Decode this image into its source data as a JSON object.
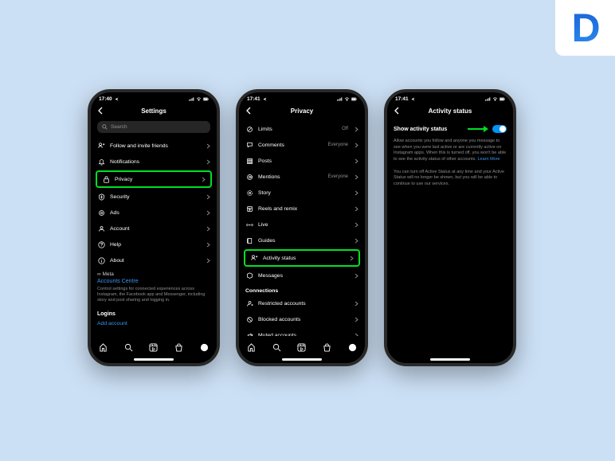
{
  "logo": {
    "letter": "D"
  },
  "status": {
    "time": "17:40",
    "nav_icon": "✈",
    "signal": "▪▪▪",
    "wifi": "⬡",
    "battery": "■"
  },
  "status2": {
    "time": "17:41"
  },
  "status3": {
    "time": "17:41"
  },
  "screen1": {
    "title": "Settings",
    "search_placeholder": "Search",
    "rows": [
      {
        "icon": "invite",
        "label": "Follow and invite friends"
      },
      {
        "icon": "bell",
        "label": "Notifications"
      },
      {
        "icon": "lock",
        "label": "Privacy",
        "highlight": true
      },
      {
        "icon": "shield",
        "label": "Security"
      },
      {
        "icon": "ads",
        "label": "Ads"
      },
      {
        "icon": "person",
        "label": "Account"
      },
      {
        "icon": "help",
        "label": "Help"
      },
      {
        "icon": "info",
        "label": "About"
      }
    ],
    "meta": {
      "logo": "∞ Meta",
      "accounts_centre": "Accounts Centre",
      "desc": "Control settings for connected experiences across Instagram, the Facebook app and Messenger, including story and post sharing and logging in."
    },
    "logins_header": "Logins",
    "add_account": "Add account"
  },
  "screen2": {
    "title": "Privacy",
    "rows_top": [
      {
        "icon": "limits",
        "label": "Limits",
        "value": "Off"
      },
      {
        "icon": "comments",
        "label": "Comments",
        "value": "Everyone"
      },
      {
        "icon": "posts",
        "label": "Posts"
      },
      {
        "icon": "mentions",
        "label": "Mentions",
        "value": "Everyone"
      },
      {
        "icon": "story",
        "label": "Story"
      },
      {
        "icon": "reels",
        "label": "Reels and remix"
      },
      {
        "icon": "live",
        "label": "Live"
      },
      {
        "icon": "guides",
        "label": "Guides"
      },
      {
        "icon": "activity",
        "label": "Activity status",
        "highlight": true
      },
      {
        "icon": "messages",
        "label": "Messages"
      }
    ],
    "connections_header": "Connections",
    "rows_conn": [
      {
        "icon": "restricted",
        "label": "Restricted accounts"
      },
      {
        "icon": "blocked",
        "label": "Blocked accounts"
      },
      {
        "icon": "muted",
        "label": "Muted accounts"
      }
    ]
  },
  "screen3": {
    "title": "Activity status",
    "toggle_label": "Show activity status",
    "desc1": "Allow accounts you follow and anyone you message to see when you were last active or are currently active on Instagram apps. When this is turned off, you won't be able to see the activity status of other accounts.",
    "learn_more": "Learn More",
    "desc2": "You can turn off Active Status at any time and your Active Status will no longer be shown, but you will be able to continue to use our services."
  },
  "nav_icons": [
    "home",
    "search",
    "reels",
    "shopping",
    "profile"
  ]
}
